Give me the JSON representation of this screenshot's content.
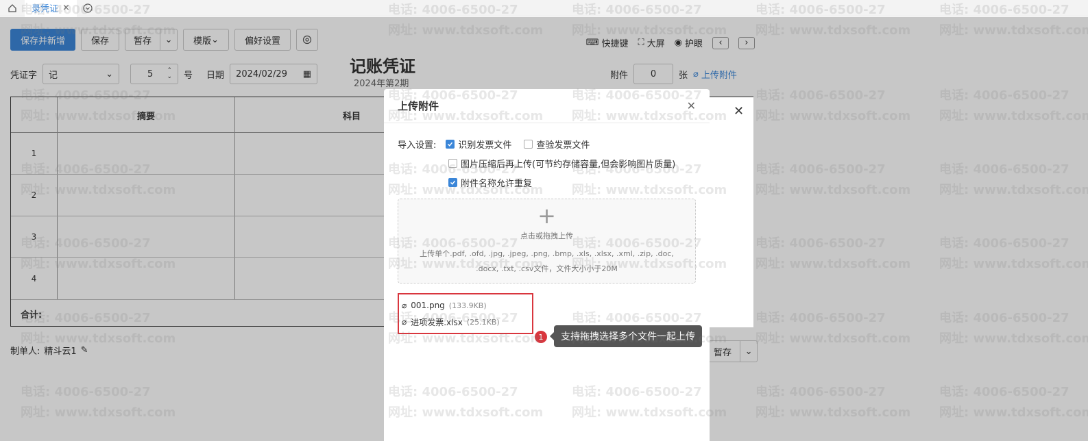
{
  "tabs": [
    {
      "label": "录凭证"
    }
  ],
  "toolbar": {
    "save_new": "保存并新增",
    "save": "保存",
    "draft": "暂存",
    "template": "模版",
    "prefs": "偏好设置"
  },
  "right_tools": {
    "shortcut": "快捷键",
    "fullscreen": "大屏",
    "eye": "护眼"
  },
  "form": {
    "voucher_word_label": "凭证字",
    "voucher_word_value": "记",
    "number_value": "5",
    "number_unit": "号",
    "date_label": "日期",
    "date_value": "2024/02/29"
  },
  "voucher": {
    "title": "记账凭证",
    "period": "2024年第2期"
  },
  "attach": {
    "label": "附件",
    "count": "0",
    "unit": "张",
    "upload_link": "上传附件"
  },
  "grid": {
    "columns": [
      "摘要",
      "科目"
    ],
    "rows": [
      "1",
      "2",
      "3",
      "4"
    ],
    "total_label": "合计:"
  },
  "maker": {
    "label": "制单人:",
    "name": "精斗云1"
  },
  "bottom": {
    "draft": "暂存"
  },
  "dialog": {
    "title": "上传附件",
    "import_label": "导入设置:",
    "options": [
      {
        "label": "识别发票文件",
        "checked": true
      },
      {
        "label": "查验发票文件",
        "checked": false
      },
      {
        "label": "图片压缩后再上传(可节约存储容量,但会影响图片质量)",
        "checked": false
      },
      {
        "label": "附件名称允许重复",
        "checked": true
      }
    ],
    "dropzone_title": "点击或拖拽上传",
    "dropzone_desc": "上传单个.pdf, .ofd, .jpg, .jpeg, .png, .bmp, .xls, .xlsx, .xml, .zip, .doc, .docx, .txt, .csv文件，文件大小小于20M",
    "files": [
      {
        "name": "001.png",
        "size": "(133.9KB)"
      },
      {
        "name": "进项发票.xlsx",
        "size": "(25.1KB)"
      }
    ]
  },
  "callout": {
    "number": "1",
    "text": "支持拖拽选择多个文件一起上传"
  },
  "watermark": {
    "phone": "电话: 4006-6500-27",
    "site": "网址: www.tdxsoft.com"
  }
}
